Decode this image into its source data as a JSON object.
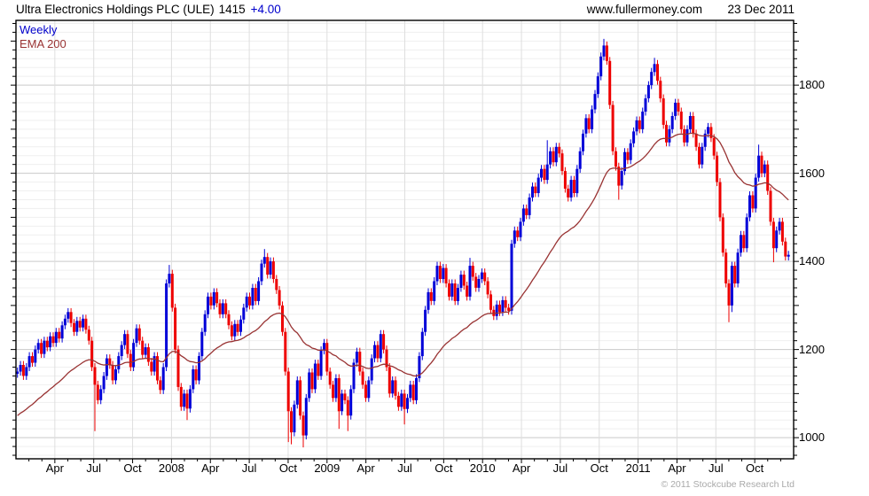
{
  "header": {
    "title": "Ultra Electronics Holdings PLC (ULE)",
    "price": "1415",
    "change": "+4.00",
    "site": "www.fullermoney.com",
    "date": "23 Dec 2011"
  },
  "legend": {
    "timeframe": "Weekly",
    "overlay": "EMA 200"
  },
  "footer": {
    "copyright": "© 2011 Stockcube Research Ltd"
  },
  "chart_data": {
    "type": "candlestick",
    "title": "Ultra Electronics Holdings PLC (ULE)",
    "last_price": 1415,
    "change": "+4.00",
    "timeframe": "Weekly",
    "overlay": "EMA 200",
    "period_start": "Jan 2007",
    "period_end": "23 Dec 2011",
    "x_axis": {
      "labels": [
        "Apr",
        "Jul",
        "Oct",
        "2008",
        "Apr",
        "Jul",
        "Oct",
        "2009",
        "Apr",
        "Jul",
        "Oct",
        "2010",
        "Apr",
        "Jul",
        "Oct",
        "2011",
        "Apr",
        "Jul",
        "Oct"
      ]
    },
    "y_axis": {
      "tick_labels": [
        1800,
        1600,
        1400,
        1200,
        1000
      ],
      "minor_step": 20,
      "min": 952,
      "max": 1947,
      "grid": true
    },
    "first_open": 1145,
    "weekly_closes": [
      1150,
      1165,
      1140,
      1160,
      1185,
      1170,
      1200,
      1215,
      1190,
      1220,
      1205,
      1230,
      1215,
      1240,
      1225,
      1255,
      1270,
      1285,
      1260,
      1240,
      1265,
      1250,
      1270,
      1245,
      1220,
      1160,
      1120,
      1085,
      1110,
      1140,
      1180,
      1165,
      1130,
      1155,
      1185,
      1210,
      1235,
      1190,
      1160,
      1215,
      1248,
      1220,
      1188,
      1205,
      1172,
      1150,
      1185,
      1130,
      1108,
      1160,
      1350,
      1372,
      1295,
      1200,
      1115,
      1070,
      1100,
      1066,
      1110,
      1155,
      1130,
      1185,
      1240,
      1280,
      1320,
      1300,
      1330,
      1305,
      1280,
      1305,
      1280,
      1255,
      1230,
      1258,
      1240,
      1268,
      1295,
      1320,
      1300,
      1340,
      1310,
      1355,
      1395,
      1410,
      1370,
      1400,
      1360,
      1335,
      1300,
      1240,
      1150,
      1060,
      1012,
      1075,
      1130,
      1050,
      1005,
      1090,
      1148,
      1110,
      1168,
      1140,
      1198,
      1215,
      1150,
      1120,
      1090,
      1135,
      1060,
      1100,
      1085,
      1050,
      1110,
      1170,
      1195,
      1150,
      1120,
      1090,
      1130,
      1180,
      1210,
      1180,
      1235,
      1200,
      1160,
      1100,
      1130,
      1095,
      1070,
      1100,
      1065,
      1090,
      1120,
      1085,
      1135,
      1185,
      1240,
      1290,
      1330,
      1310,
      1355,
      1390,
      1360,
      1385,
      1350,
      1320,
      1350,
      1310,
      1340,
      1370,
      1345,
      1320,
      1390,
      1365,
      1340,
      1360,
      1375,
      1355,
      1325,
      1290,
      1276,
      1302,
      1285,
      1312,
      1295,
      1288,
      1440,
      1470,
      1455,
      1490,
      1520,
      1505,
      1545,
      1570,
      1555,
      1590,
      1610,
      1585,
      1620,
      1650,
      1625,
      1660,
      1645,
      1605,
      1565,
      1545,
      1585,
      1555,
      1610,
      1650,
      1690,
      1725,
      1700,
      1745,
      1780,
      1820,
      1865,
      1890,
      1855,
      1755,
      1650,
      1615,
      1572,
      1605,
      1648,
      1630,
      1668,
      1695,
      1720,
      1700,
      1740,
      1770,
      1800,
      1830,
      1848,
      1810,
      1770,
      1710,
      1670,
      1700,
      1730,
      1760,
      1740,
      1700,
      1670,
      1700,
      1730,
      1690,
      1660,
      1620,
      1660,
      1690,
      1705,
      1680,
      1640,
      1580,
      1500,
      1420,
      1350,
      1300,
      1390,
      1350,
      1420,
      1460,
      1430,
      1500,
      1550,
      1520,
      1590,
      1640,
      1600,
      1620,
      1560,
      1490,
      1430,
      1470,
      1490,
      1445,
      1411,
      1415
    ],
    "wick_overrides": {
      "26": {
        "low": 1015
      },
      "51": {
        "high": 1392
      },
      "57": {
        "low": 1040
      },
      "83": {
        "high": 1428
      },
      "91": {
        "low": 990
      },
      "92": {
        "low": 985
      },
      "96": {
        "low": 978
      },
      "108": {
        "low": 1020
      },
      "111": {
        "low": 1015
      },
      "130": {
        "low": 1030
      },
      "152": {
        "high": 1408
      },
      "178": {
        "high": 1675
      },
      "197": {
        "high": 1905
      },
      "202": {
        "low": 1540
      },
      "214": {
        "high": 1862
      },
      "239": {
        "low": 1262
      },
      "240": {
        "low": 1285
      },
      "249": {
        "high": 1665
      },
      "254": {
        "low": 1398
      }
    },
    "ema": {
      "label": "EMA 200",
      "period_weeks": 40,
      "seed": 1045
    },
    "colors": {
      "up": "#0000d8",
      "down": "#ee0000",
      "ema": "#993333",
      "change_text": "#0000cc",
      "timeframe_text": "#0000cc",
      "grid_minor": "#efefef",
      "grid_major": "#c9c9c9",
      "grid_vertical": "#dedede",
      "border": "#000000",
      "copyright_text": "#a9a9a9"
    },
    "legend_position": "top-left"
  }
}
